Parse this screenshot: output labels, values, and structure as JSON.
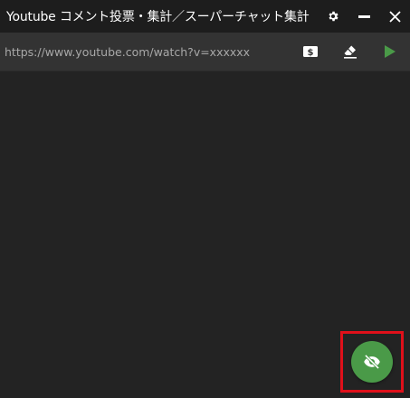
{
  "window": {
    "title": "Youtube コメント投票・集計／スーパーチャット集計"
  },
  "url_bar": {
    "placeholder": "https://www.youtube.com/watch?v=xxxxxx",
    "value": ""
  },
  "toolbar": {
    "superchat_icon": "dollar-bill-icon",
    "clear_icon": "eraser-icon",
    "start_icon": "play-icon"
  },
  "fab": {
    "icon": "eye-off-icon"
  },
  "colors": {
    "background": "#232323",
    "titlebar": "#1d1d1d",
    "urlbar": "#333333",
    "accent_green": "#4a9a48",
    "highlight_red": "#e0101a"
  }
}
